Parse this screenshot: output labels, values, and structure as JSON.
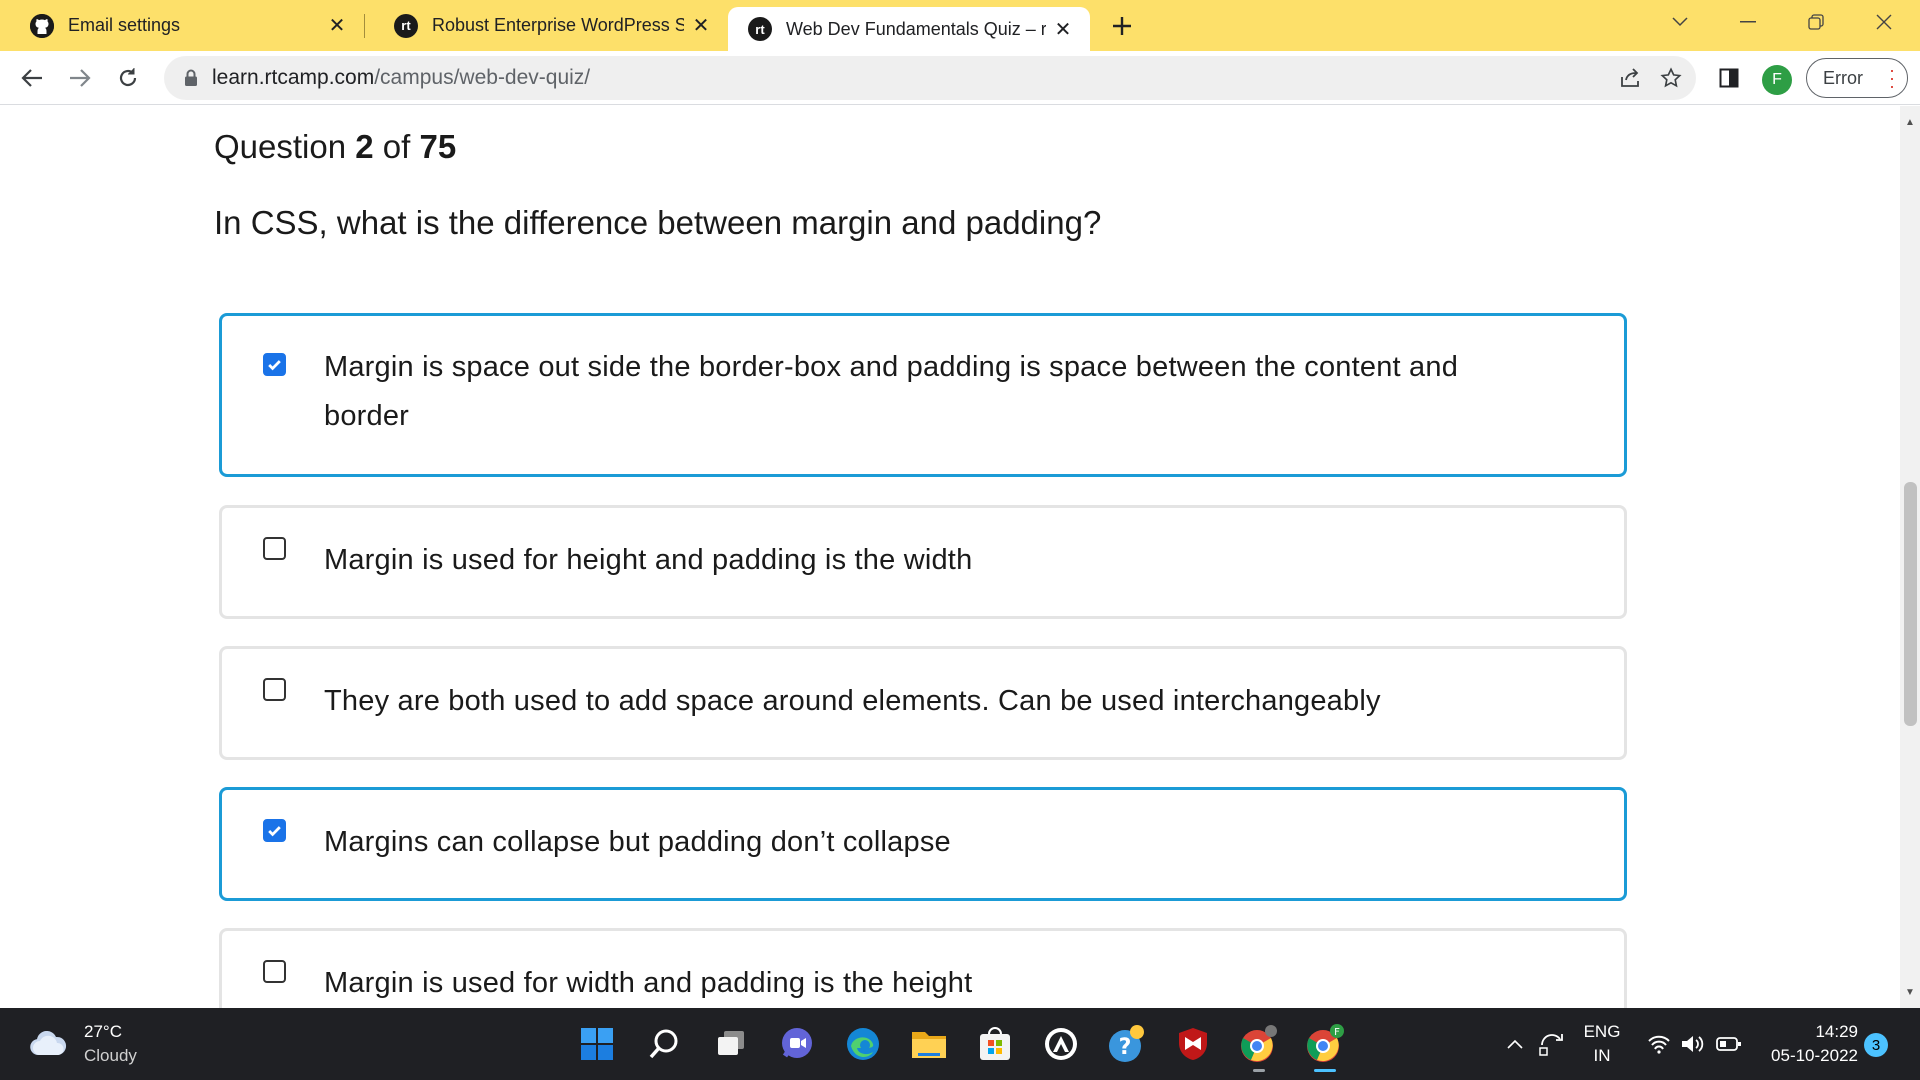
{
  "browser": {
    "tabs": [
      {
        "title": "Email settings",
        "icon": "github-icon"
      },
      {
        "title": "Robust Enterprise WordPress Sol",
        "icon": "rtcamp-icon"
      },
      {
        "title": "Web Dev Fundamentals Quiz – rt",
        "icon": "rtcamp-icon",
        "active": true
      }
    ],
    "tab_icon_letter": "rt",
    "url_host": "learn.rtcamp.com",
    "url_path": "/campus/web-dev-quiz/",
    "profile_initial": "F",
    "error_label": "Error",
    "colors": {
      "tabstrip": "#fde06a",
      "profile": "#2e9e45"
    }
  },
  "quiz": {
    "counter_prefix": "Question",
    "current": "2",
    "counter_of": "of",
    "total": "75",
    "question": "In CSS, what is the difference between margin and padding?",
    "options": [
      {
        "text": "Margin is space out side the border-box and padding is space between the content and border",
        "checked": true
      },
      {
        "text": "Margin is used for height and padding is the width",
        "checked": false
      },
      {
        "text": "They are both used to add space around elements. Can be used interchangeably",
        "checked": false
      },
      {
        "text": "Margins can collapse but padding don’t collapse",
        "checked": true
      },
      {
        "text": "Margin is used for width and padding is the height",
        "checked": false
      }
    ],
    "colors": {
      "selected_border": "#1b9bd6",
      "checkbox": "#1a73e8"
    }
  },
  "taskbar": {
    "weather_temp": "27°C",
    "weather_desc": "Cloudy",
    "apps": [
      "windows-start-icon",
      "search-icon",
      "task-view-icon",
      "teams-chat-icon",
      "edge-icon",
      "file-explorer-icon",
      "microsoft-store-icon",
      "app-circle-icon",
      "help-icon",
      "mcafee-icon",
      "chrome-icon",
      "chrome-profile-icon"
    ],
    "lang_1": "ENG",
    "lang_2": "IN",
    "time": "14:29",
    "date": "05-10-2022",
    "notifications": "3"
  }
}
